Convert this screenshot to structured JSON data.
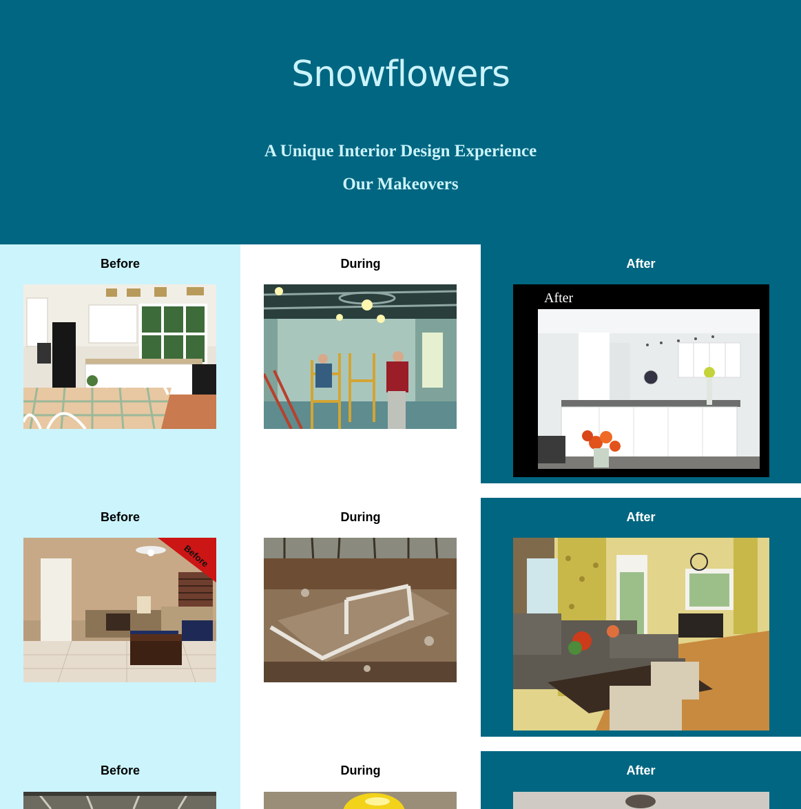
{
  "header": {
    "brand": "Snowflowers",
    "tagline": "A Unique Interior Design Experience",
    "section_title": "Our Makeovers"
  },
  "columns": {
    "before_label": "Before",
    "during_label": "During",
    "after_label": "After"
  },
  "photos": {
    "after_1_caption": "After",
    "before_2_ribbon": "Before"
  },
  "colors": {
    "header_bg": "#006681",
    "brand_text": "#cbf3fb",
    "before_column_bg": "#ccf4fd",
    "after_block_bg": "#006681"
  }
}
